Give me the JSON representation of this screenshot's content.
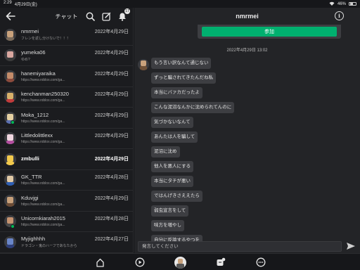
{
  "status_bar": {
    "time": "2:29",
    "date": "4月29日(金)",
    "battery": "46%"
  },
  "left": {
    "title": "チャット",
    "notification_count": "17",
    "chats": [
      {
        "name": "nmrmei",
        "date": "2022年4月29日",
        "preview": "フレンを返し分けないで！！！",
        "face": "#c9a27c",
        "body": "#7a6a5a",
        "online": false,
        "bold": false
      },
      {
        "name": "yumeka06",
        "date": "2022年4月29日",
        "preview": "ゆめ?",
        "face": "#d9a7a0",
        "body": "#3a3a3a",
        "online": false,
        "bold": false
      },
      {
        "name": "hanemiyaraika",
        "date": "2022年4月29日",
        "preview": "https://www.roblox.com/ga...",
        "face": "#c48c6a",
        "body": "#8b4a3c",
        "online": false,
        "bold": false
      },
      {
        "name": "kenchanman250320",
        "date": "2022年4月29日",
        "preview": "https://www.roblox.com/ga...",
        "face": "#d8b06a",
        "body": "#c23b3b",
        "online": false,
        "bold": false
      },
      {
        "name": "Moka_1212",
        "date": "2022年4月29日",
        "preview": "https://www.roblox.com/ga...",
        "face": "#e5d0a2",
        "body": "#5b6fb0",
        "online": true,
        "bold": false
      },
      {
        "name": "Littledolittlexx",
        "date": "2022年4月29日",
        "preview": "https://www.roblox.com/ga...",
        "face": "#f0d6e0",
        "body": "#b44fa0",
        "online": false,
        "bold": false
      },
      {
        "name": "zmbulli",
        "date": "2022年4月29日",
        "preview": "",
        "face": "#f2c94c",
        "body": "#f2c94c",
        "online": false,
        "bold": true
      },
      {
        "name": "GK_TTR",
        "date": "2022年4月28日",
        "preview": "https://www.roblox.com/ga...",
        "face": "#e0c9a6",
        "body": "#2f5fb3",
        "online": false,
        "bold": false
      },
      {
        "name": "Kduvjgi",
        "date": "2022年4月29日",
        "preview": "https://www.roblox.com/ga...",
        "face": "#c8a07a",
        "body": "#6b4b35",
        "online": false,
        "bold": false
      },
      {
        "name": "Unicornkiarah2015",
        "date": "2022年4月28日",
        "preview": "https://www.roblox.com/ga...",
        "face": "#c59370",
        "body": "#4a4a4a",
        "online": true,
        "bold": false
      },
      {
        "name": "Myjighhhh",
        "date": "2022年4月27日",
        "preview": "ドラゴン・鬼のハーフであなたから",
        "face": "#6a86c9",
        "body": "#2d3e7a",
        "online": false,
        "bold": false
      }
    ]
  },
  "right": {
    "title": "nmrmei",
    "join_label": "参加",
    "timestamp": "2022年4月29日 13:02",
    "messages": [
      "もう言い訳なんて通じない",
      "ずっと騙されてきたんだね私",
      "本当にバァカだったよ",
      "こんな泥沼なんかに沈められてんのに",
      "気づかないなんて",
      "あんたは人を騙して",
      "泥沼に沈め",
      "他人を悪人にする",
      "本当にタチが悪い",
      "ではんげきさええたら",
      "弱虫宣言をして",
      "味方を増やし",
      "自分に反論するやつを"
    ],
    "input_placeholder": "発言してください"
  },
  "colors": {
    "accent_green": "#00b06f",
    "online": "#02b757"
  },
  "nav_icons": [
    "home-icon",
    "play-icon",
    "avatar",
    "chat-icon",
    "more-icon"
  ]
}
